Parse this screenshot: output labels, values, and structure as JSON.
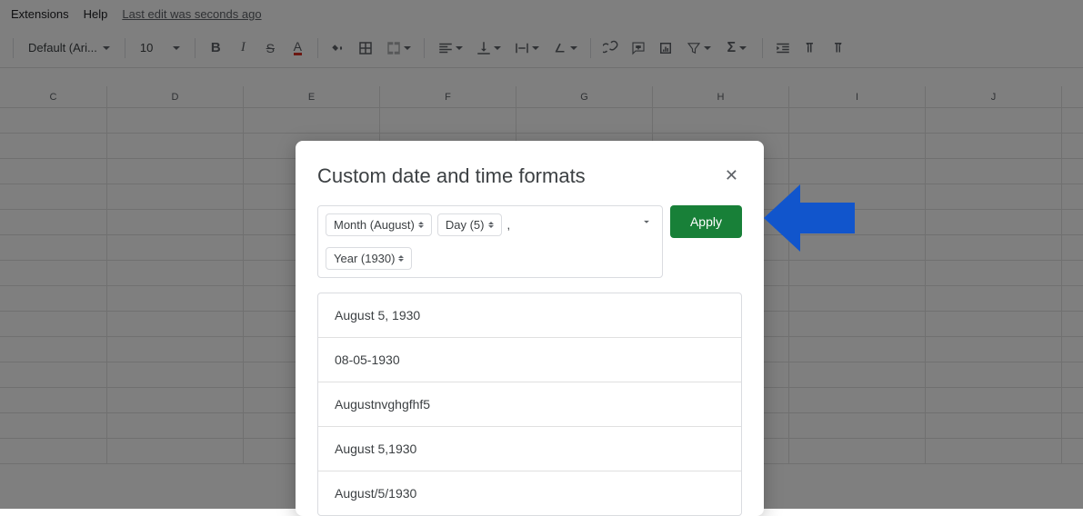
{
  "menu": {
    "extensions": "Extensions",
    "help": "Help",
    "last_edit": "Last edit was seconds ago"
  },
  "toolbar": {
    "font": "Default (Ari...",
    "size": "10"
  },
  "columns": [
    "C",
    "D",
    "E",
    "F",
    "G",
    "H",
    "I",
    "J"
  ],
  "dialog": {
    "title": "Custom date and time formats",
    "tokens": {
      "month": "Month (August)",
      "day": "Day (5)",
      "year": "Year (1930)",
      "comma": ","
    },
    "apply": "Apply",
    "formats": [
      "August 5, 1930",
      "08-05-1930",
      "Augustnvghgfhf5",
      "August 5,1930",
      "August/5/1930"
    ]
  },
  "annotation": {
    "arrow_color": "#1155cc"
  }
}
